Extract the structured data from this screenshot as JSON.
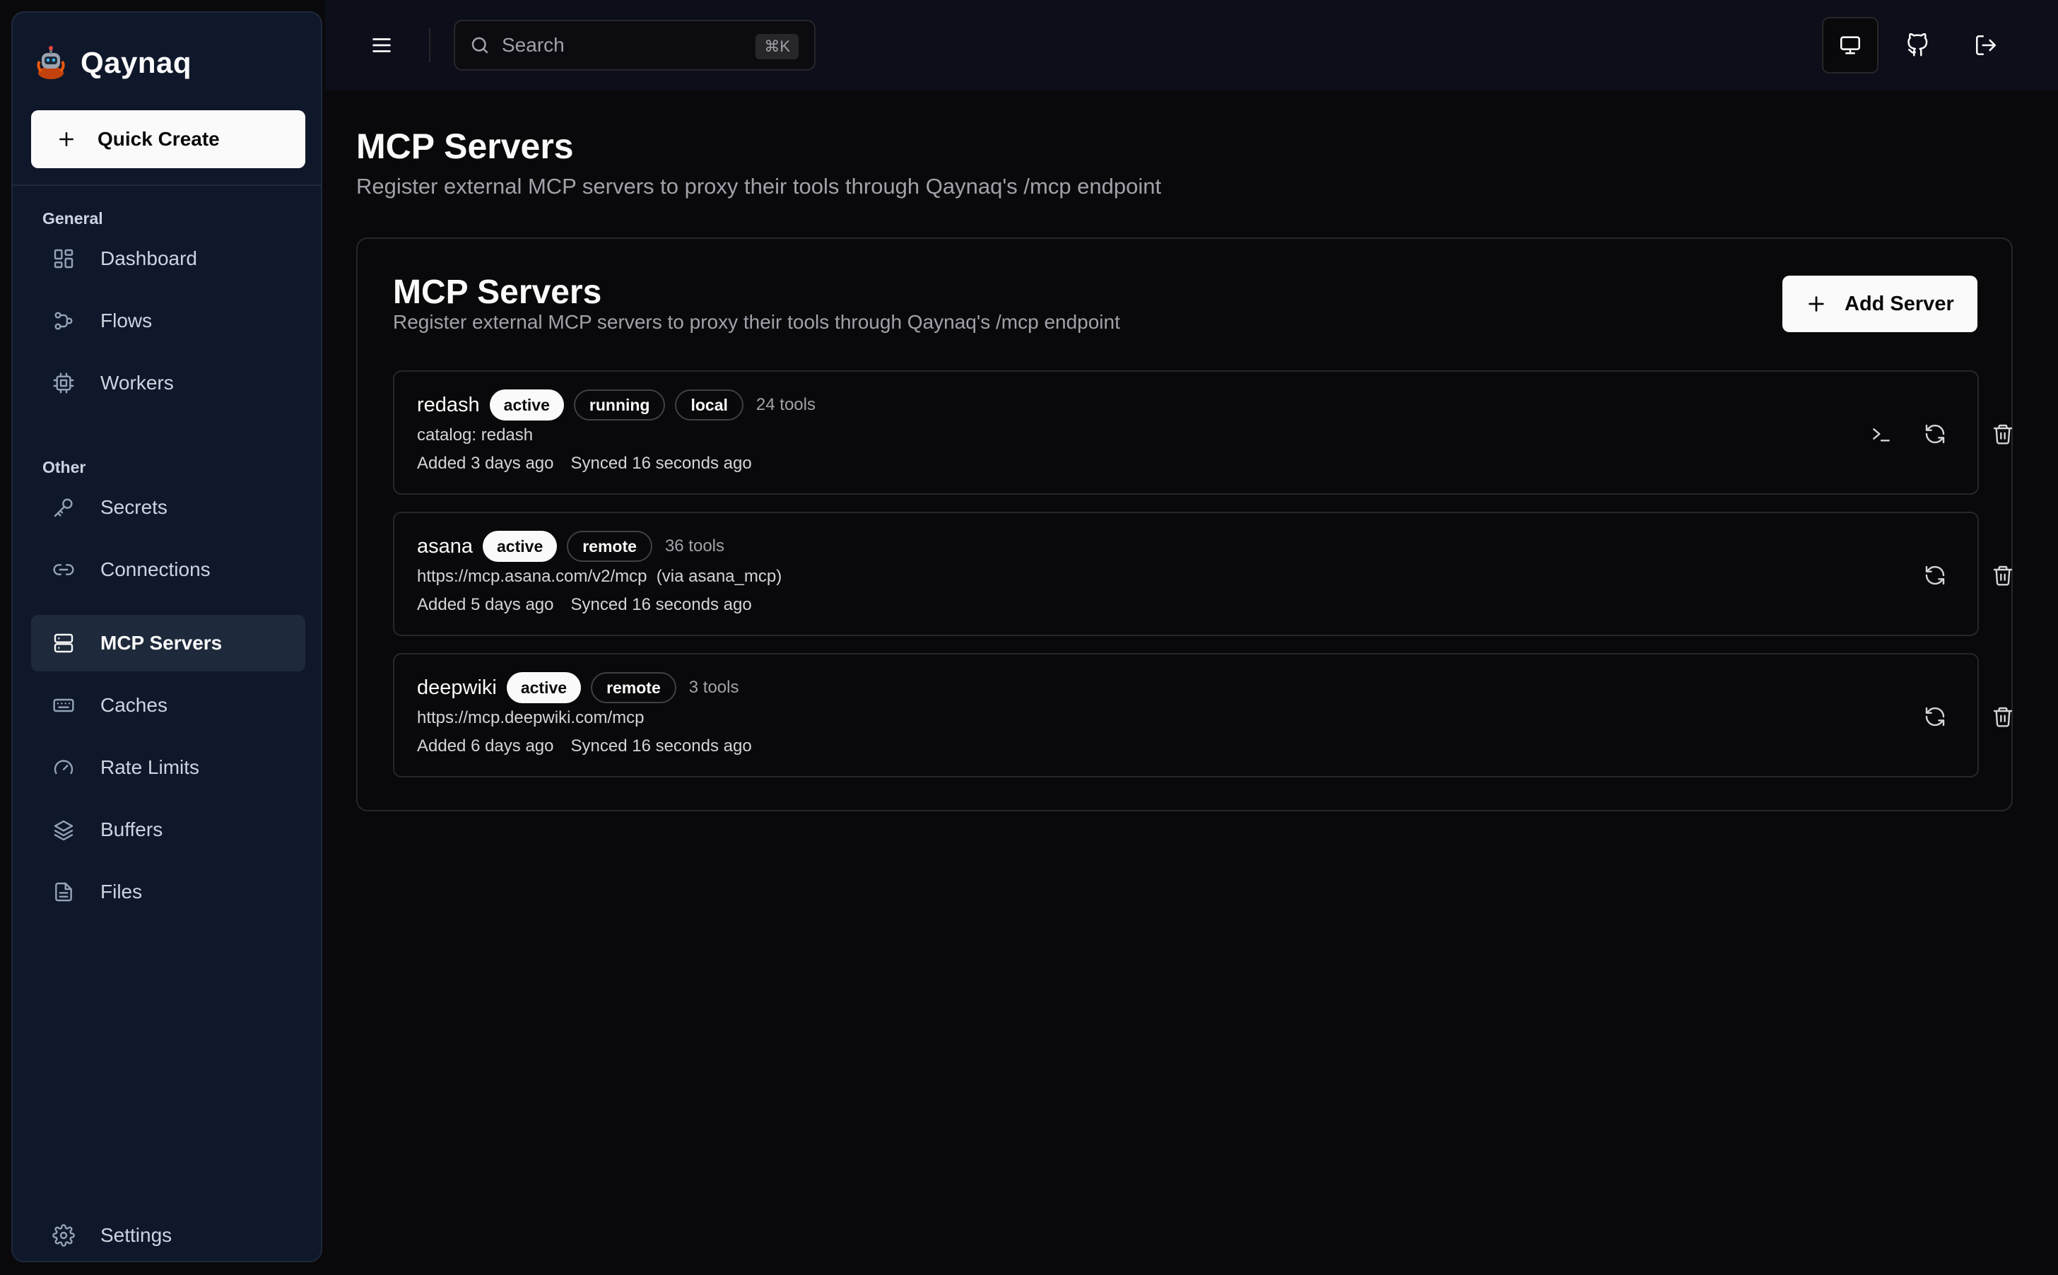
{
  "brand": {
    "name": "Qaynaq"
  },
  "sidebar": {
    "quick_create": "Quick Create",
    "groups": [
      {
        "label": "General",
        "items": [
          {
            "label": "Dashboard",
            "icon": "dashboard-icon"
          },
          {
            "label": "Flows",
            "icon": "flows-icon"
          },
          {
            "label": "Workers",
            "icon": "cpu-icon"
          }
        ]
      },
      {
        "label": "Other",
        "items": [
          {
            "label": "Secrets",
            "icon": "key-icon"
          },
          {
            "label": "Connections",
            "icon": "link-icon"
          },
          {
            "label": "MCP Servers",
            "icon": "server-icon",
            "active": true
          },
          {
            "label": "Caches",
            "icon": "keyboard-icon"
          },
          {
            "label": "Rate Limits",
            "icon": "gauge-icon"
          },
          {
            "label": "Buffers",
            "icon": "layers-icon"
          },
          {
            "label": "Files",
            "icon": "file-icon"
          }
        ]
      }
    ],
    "settings": "Settings"
  },
  "header": {
    "search_placeholder": "Search",
    "search_shortcut": "⌘K"
  },
  "page": {
    "title": "MCP Servers",
    "subtitle": "Register external MCP servers to proxy their tools through Qaynaq's /mcp endpoint"
  },
  "card": {
    "title": "MCP Servers",
    "subtitle": "Register external MCP servers to proxy their tools through Qaynaq's /mcp endpoint",
    "add_button": "Add Server"
  },
  "servers": [
    {
      "name": "redash",
      "badges": [
        "active",
        "running",
        "local"
      ],
      "tools": "24 tools",
      "detail": "catalog: redash",
      "added": "Added 3 days ago",
      "synced": "Synced 16 seconds ago",
      "has_terminal": true
    },
    {
      "name": "asana",
      "badges": [
        "active",
        "remote"
      ],
      "tools": "36 tools",
      "detail": "https://mcp.asana.com/v2/mcp  (via asana_mcp)",
      "added": "Added 5 days ago",
      "synced": "Synced 16 seconds ago",
      "has_terminal": false
    },
    {
      "name": "deepwiki",
      "badges": [
        "active",
        "remote"
      ],
      "tools": "3 tools",
      "detail": "https://mcp.deepwiki.com/mcp",
      "added": "Added 6 days ago",
      "synced": "Synced 16 seconds ago",
      "has_terminal": false
    }
  ]
}
